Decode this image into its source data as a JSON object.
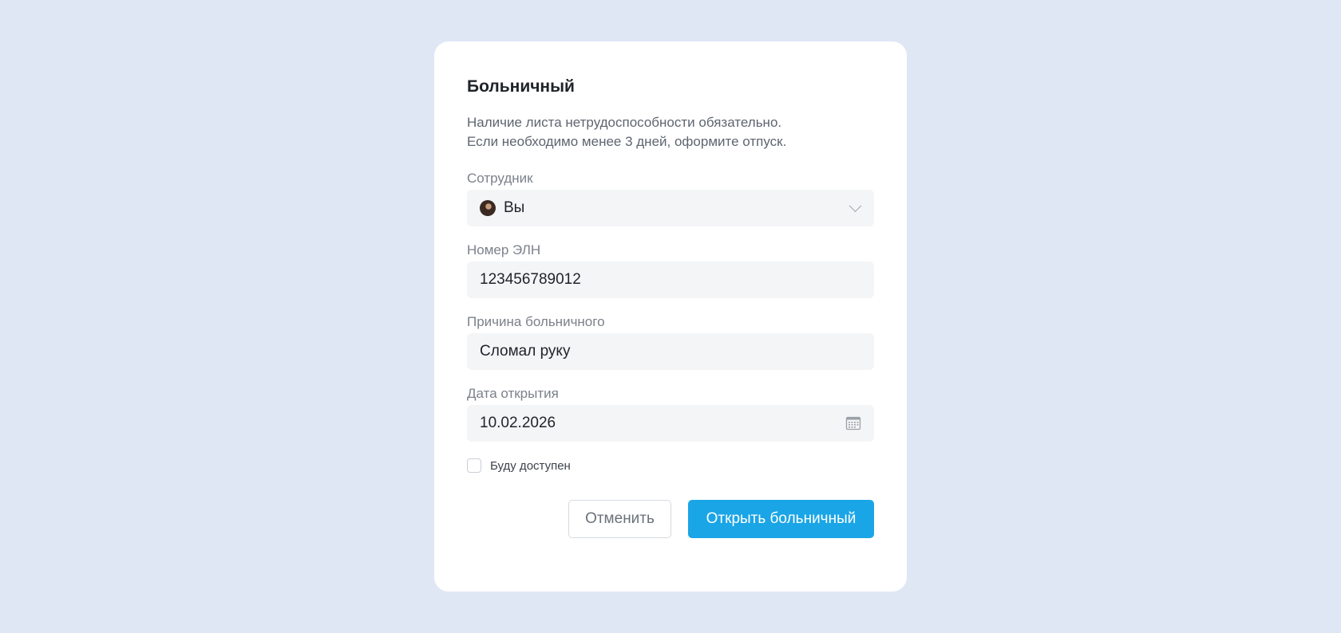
{
  "dialog": {
    "title": "Больничный",
    "description_line1": "Наличие листа нетрудоспособности обязательно.",
    "description_line2": "Если необходимо менее 3 дней, оформите отпуск."
  },
  "employee": {
    "label": "Сотрудник",
    "value": "Вы"
  },
  "eln_number": {
    "label": "Номер ЭЛН",
    "value": "123456789012"
  },
  "reason": {
    "label": "Причина больничного",
    "value": "Сломал руку"
  },
  "open_date": {
    "label": "Дата открытия",
    "value": "10.02.2026"
  },
  "available_checkbox": {
    "label": "Буду доступен",
    "checked": false
  },
  "buttons": {
    "cancel": "Отменить",
    "submit": "Открыть больничный"
  },
  "colors": {
    "background": "#e0e7f4",
    "primary": "#1aa5e6",
    "field_bg": "#f4f5f7"
  },
  "icons": {
    "employee_dropdown": "chevron-down-icon",
    "date_picker": "calendar-icon"
  }
}
